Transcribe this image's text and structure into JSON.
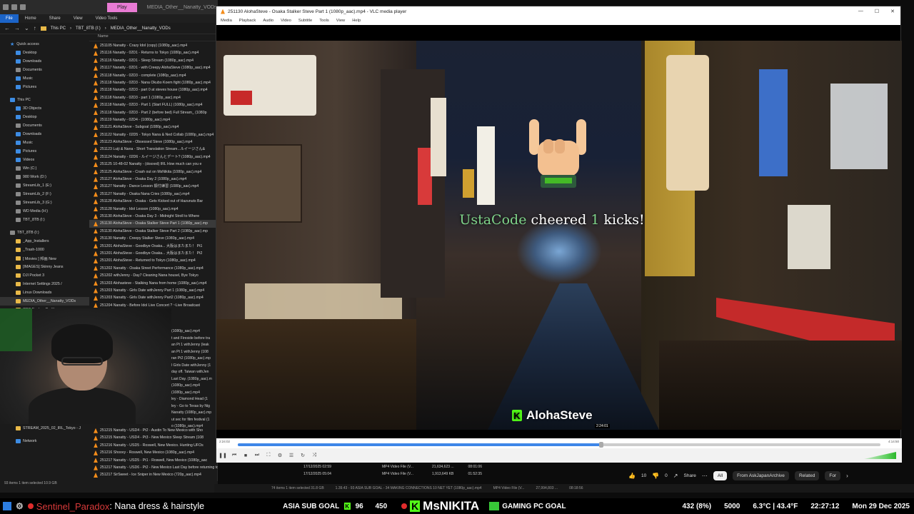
{
  "explorer": {
    "tab_play": "Play",
    "window_title": "MEDIA_Other__Nanatty_VODs",
    "ribbon": [
      "File",
      "Home",
      "Share",
      "View",
      "Video Tools"
    ],
    "breadcrumb": [
      "This PC",
      "TBT_8TB (I:)",
      "MEDIA_Other__Nanatty_VODs"
    ],
    "column_name": "Name",
    "nav_items": [
      {
        "label": "Quick access",
        "icon": "star",
        "group": true
      },
      {
        "label": "Desktop",
        "icon": "blue"
      },
      {
        "label": "Downloads",
        "icon": "blue"
      },
      {
        "label": "Documents",
        "icon": "gray"
      },
      {
        "label": "Music",
        "icon": "blue"
      },
      {
        "label": "Pictures",
        "icon": "blue"
      },
      {
        "label": "",
        "gap": true
      },
      {
        "label": "This PC",
        "icon": "blue",
        "group": true
      },
      {
        "label": "3D Objects",
        "icon": "blue"
      },
      {
        "label": "Desktop",
        "icon": "blue"
      },
      {
        "label": "Documents",
        "icon": "gray"
      },
      {
        "label": "Downloads",
        "icon": "blue"
      },
      {
        "label": "Music",
        "icon": "blue"
      },
      {
        "label": "Pictures",
        "icon": "blue"
      },
      {
        "label": "Videos",
        "icon": "blue"
      },
      {
        "label": "Win (C:)",
        "icon": "gray"
      },
      {
        "label": "980 Work (D:)",
        "icon": "gray"
      },
      {
        "label": "StreamLib_1 (E:)",
        "icon": "gray"
      },
      {
        "label": "StreamLib_2 (F:)",
        "icon": "gray"
      },
      {
        "label": "StreamLib_3 (G:)",
        "icon": "gray"
      },
      {
        "label": "WD Media (H:)",
        "icon": "gray"
      },
      {
        "label": "TBT_8TB (I:)",
        "icon": "gray"
      },
      {
        "label": "",
        "gap": true
      },
      {
        "label": "TBT_8TB (I:)",
        "icon": "gray",
        "group": true
      },
      {
        "label": "_App_Installers",
        "icon": "yellow"
      },
      {
        "label": "_Trash-1000",
        "icon": "yellow"
      },
      {
        "label": "[ Movies ] 邦画 New",
        "icon": "yellow"
      },
      {
        "label": "[IMAGES] Skinny Jeans",
        "icon": "yellow"
      },
      {
        "label": "DJI Pocket 3",
        "icon": "yellow"
      },
      {
        "label": "Internet Settings 2025 /",
        "icon": "yellow"
      },
      {
        "label": "Linux Downloads",
        "icon": "yellow"
      },
      {
        "label": "MEDIA_Other__Nanatty_VODs",
        "icon": "yellow",
        "selected": true
      },
      {
        "label": "OBS Backup Profiles",
        "icon": "yellow"
      }
    ],
    "files": [
      "251105 Nanatty - Crazy Idol (copy) (1080p_aac).mp4",
      "251116 Nanatty - 02D1 - Returns to Tokyo (1080p_aac).mp4",
      "251116 Nanatty - 02D1 - Sleep Stream (1080p_aac).mp4",
      "251117 Nanatty - 02D1 - with Creepy AlohaSteve (1080p_aac).mp4",
      "251118 Nanatty - 02D3 - complete (1080p_aac).mp4",
      "251118 Nanatty - 02D3 - Nana Okubo Koem fight (1080p_aac).mp4",
      "251118 Nanatty - 02D3 - part 0 at steves house (1080p_aac).mp4",
      "251118 Nanatty - 02D3 - part 1 (1080p_aac).mp4",
      "251118 Nanatty - 02D3 - Part 1 (Start FULL) (1080p_aac).mp4",
      "251118 Nanatty - 02D3 - Part 2 (before bed) Full Stream_ (1080p",
      "251119 Nanatty - 02D4 - (1080p_aac).mp4",
      "251121 AlohaSteve - Subgoal (1080p_aac).mp4",
      "251122 Nanatty - 02D5 - Tokyo Nana & Ned Collab (1080p_aac).mp4",
      "251123 AlohaSteve - Obsessed Steve (1080p_aac).mp4",
      "251123 Luiji & Nana - Short Translation Stream...ルイージさん&",
      "251124 Nanatty - 02D6 - ルイージさんとデート? (1080p_aac).mp4",
      "251125 10-48-02 Nanatty - (dosxed) IRL How much can you e",
      "251125 AlohaSteve - Crash out on MsNikita (1080p_aac).mp4",
      "251127 AlohaSteve - Osaka Day 2 (1080p_aac).mp4",
      "251127 Nanatty - Dance Lesson 振付練習 (1080p_aac).mp4",
      "251127 Nanatty - Osaka Nana Cries (1080p_aac).mp4",
      "251128 AlohaSteve - Osaka - Gets Kicked out of Hazunuts Bar",
      "251128 Nanatty - Idol Lesson (1080p_aac).mp4",
      "251130 AlohaSteve - Osaka Day 3 - Midnight Stroll to Where",
      "251130 AlohaSteve - Osaka Stalker Steve Part 1 (1080p_aac).mp",
      "251130 AlohaSteve - Osaka Stalker Steve Part 2 (1080p_aac).mp",
      "251130 Nanatty - Creepy Stalker Steve (1080p_aac).mp4",
      "251201 AlohaSteve - Goodbye Osaka... 大阪はまたまた！ Pt1",
      "251201 AlohaSteve - Goodbye Osaka... 大阪はまたまた！ Pt2",
      "251201 AlohaSteve - Returned to Tokyo (1080p_aac).mp4",
      "251202 Nanatty - Osaka Street Performance (1080p_aac).mp4",
      "251202 withJenny - Day7 Cleaning Nana housel, Bye Tokyo",
      "251203 Alohasteve - Stalking Nana from home (1080p_aac).mp4",
      "251203 Nanatty - Girls Date withJenny Part 1 (1080p_aac).mp4",
      "251203 Nanatty - Girls Date withJenny Part2 (1080p_aac).mp4",
      "251204 Nanatty - Before Idol Live Concert ? ~Live Broadcast"
    ],
    "lower_list": [
      "(1080p_aac).mp4",
      "t and Fireside before tra",
      "an Pt 1 withJenny (leak",
      "an Pt 1 withJenny (108",
      "ran Pt2 (1080p_aac).mp",
      "l Girls Date withJenny (1",
      "day off. Taiwan withJen",
      "Last Day. (1080p_aac).m",
      "(1080p_aac).mp4",
      "(1080p_aac).mp4",
      "ley - Diamond Head (1",
      "ley - Go to Texas by Nig",
      "Nanatty (1080p_aac).mp",
      "ut sec for film festival (1",
      "o (1080p_aac).mp4",
      "Austin TX with Adriana"
    ],
    "nav_lower": [
      {
        "label": "STREAM_2025_02_IRL_Tokyo - J",
        "icon": "yellow"
      },
      {
        "label": "",
        "gap": true
      },
      {
        "label": "Network",
        "icon": "blue"
      }
    ],
    "bottom_files": [
      "251215 Nanatty - USD4 - Pt2 - Austin To New Mexico with Sho",
      "251215 Nanatty - USD4 - Pt3 - New Mexico Sleep Stream (108",
      "251216 Nanatty - USD5 - Roswell, New Mexico. Hunting UFOs",
      "251216 Shoovy - Roswell, New Mexico (1080p_aac).mp4",
      "251217 Nanatty - USD5 - Pt1 - Roswell, New Mexico (1080p_aac",
      "251217 Nanatty - USD6 - Pt2 - New Mexico Last Day before returning to Austin (1080p_aac).mp4",
      "251217 SirSweet - Ice Sniper in New Mexico (720p_aac).mp4"
    ],
    "bottom_rows_meta": [
      {
        "date": "17/12/2025 02:59",
        "type": "MP4 Video File (V...",
        "size": "21,634,623 ...",
        "dur": "08:01:06"
      },
      {
        "date": "17/12/2025 05:04",
        "type": "MP4 Video File (V...",
        "size": "1,913,649 KB",
        "dur": "01:52:35"
      }
    ],
    "status": "93 items   1 item selected  10.9 GB"
  },
  "vlc": {
    "title": "251130 AlohaSteve - Osaka Stalker Steve Part 1 (1080p_aac).mp4 - VLC media player",
    "menu": [
      "Media",
      "Playback",
      "Audio",
      "Video",
      "Subtitle",
      "Tools",
      "View",
      "Help"
    ],
    "time_elapsed": "2:24:02",
    "time_total": "4:14:50",
    "tooltip_time": "2:24:01",
    "progress": 0.566,
    "volume_pct": 100,
    "overlay": {
      "cheer_user": "UstaCode",
      "cheer_word": "cheered",
      "cheer_count": "1",
      "cheer_suffix": "kicks!",
      "channel": "AlohaSteve"
    }
  },
  "browser": {
    "likes": "10",
    "dislikes": "0",
    "share": "Share",
    "chips": [
      "All",
      "From AskJapanArchive",
      "Related",
      "For"
    ]
  },
  "lower_strip": {
    "left_status": "74 items   1 item selected  31.8 GB",
    "center": "1.39.43 - 93 ASIA SUB GOAL  - 34 MAKING CONNECTIONS  10 NET YET (1080p_aac).mp4",
    "type": "MP4 Video File (V...",
    "size": "27,994,803 ...",
    "dur": "08:18:56"
  },
  "stream_bar": {
    "username": "Sentinel_Paradox",
    "ticker": ": Nana dress & hairstyle",
    "goal_label": "ASIA SUB GOAL",
    "goal_current": "96",
    "goal_target": "450",
    "sponsor": "MsNIKITA",
    "pc_goal": "GAMING PC GOAL",
    "pc_progress": "432 (8%)",
    "pc_target": "5000",
    "weather": "6.3°C | 43.4°F",
    "time": "22:27:12",
    "date": "Mon 29 Dec 2025"
  }
}
